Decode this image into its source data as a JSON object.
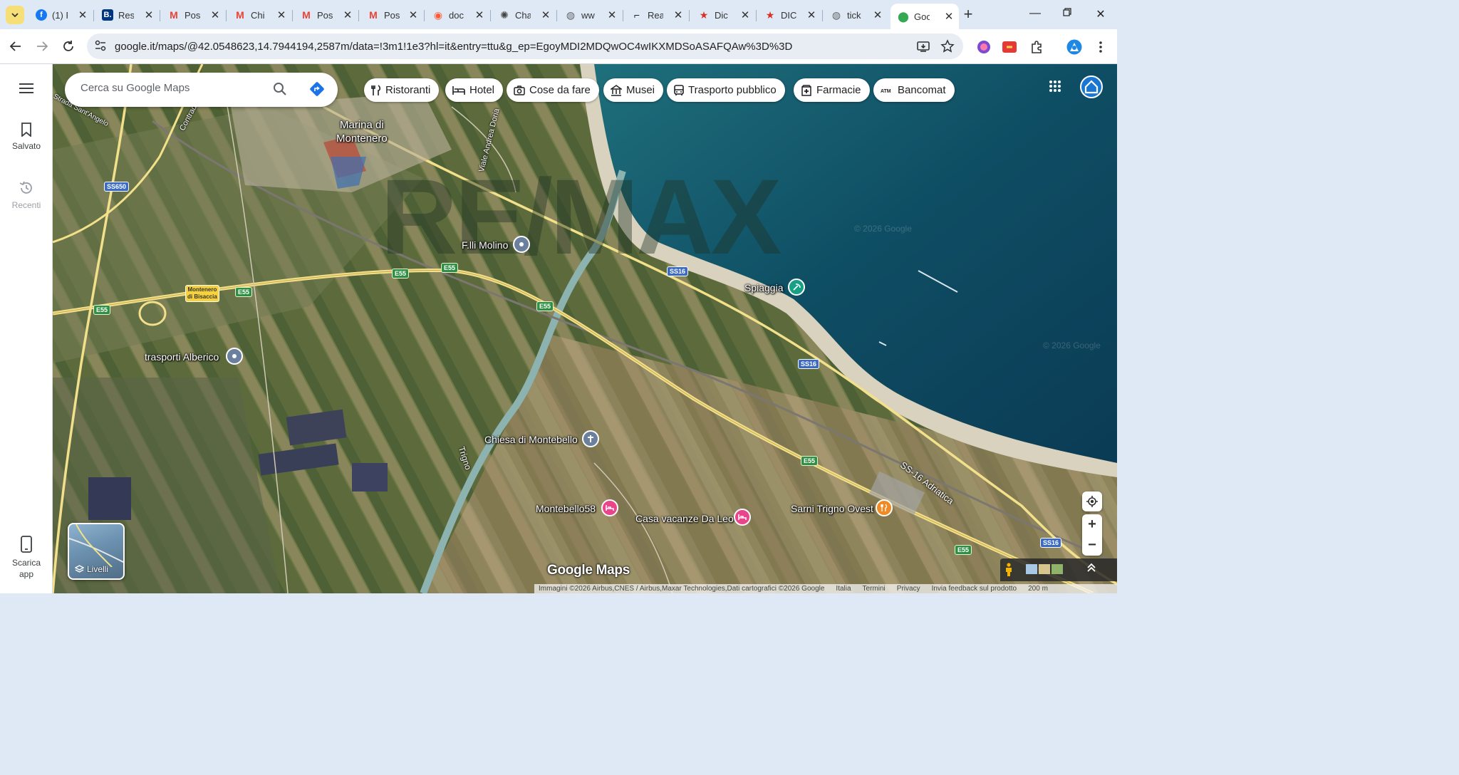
{
  "browser": {
    "tabs": [
      {
        "label": "(1) F",
        "favicon": "facebook",
        "color": "#1877f2"
      },
      {
        "label": "Res",
        "favicon": "booking",
        "color": "#003580"
      },
      {
        "label": "Pos",
        "favicon": "gmail",
        "color": "#ea4335"
      },
      {
        "label": "Chi",
        "favicon": "gmail",
        "color": "#ea4335"
      },
      {
        "label": "Pos",
        "favicon": "gmail",
        "color": "#ea4335"
      },
      {
        "label": "Pos",
        "favicon": "gmail",
        "color": "#ea4335"
      },
      {
        "label": "doc",
        "favicon": "doc",
        "color": "#ff5a36"
      },
      {
        "label": "Cha",
        "favicon": "chatgpt",
        "color": "#444444"
      },
      {
        "label": "ww",
        "favicon": "globe",
        "color": "#5f6368"
      },
      {
        "label": "Rea",
        "favicon": "read",
        "color": "#222222"
      },
      {
        "label": "Dic",
        "favicon": "star",
        "color": "#d93025"
      },
      {
        "label": "DIC",
        "favicon": "star",
        "color": "#d93025"
      },
      {
        "label": "tick",
        "favicon": "globe",
        "color": "#5f6368"
      },
      {
        "label": "Goo",
        "favicon": "maps-pin",
        "color": "#34a853",
        "active": true
      }
    ],
    "new_tab_icon": "plus-icon",
    "url": "google.it/maps/@42.0548623,14.7944194,2587m/data=!3m1!1e3?hl=it&entry=ttu&g_ep=EgoyMDI2MDQwOC4wIKXMDSoASAFQAw%3D%3D"
  },
  "rail": {
    "saved_label": "Salvato",
    "recent_label": "Recenti",
    "download_label": "Scarica app"
  },
  "search": {
    "placeholder": "Cerca su Google Maps"
  },
  "chips": [
    {
      "label": "Ristoranti",
      "icon": "fork-knife-icon"
    },
    {
      "label": "Hotel",
      "icon": "bed-icon"
    },
    {
      "label": "Cose da fare",
      "icon": "camera-icon"
    },
    {
      "label": "Musei",
      "icon": "museum-icon"
    },
    {
      "label": "Trasporto pubblico",
      "icon": "bus-icon"
    },
    {
      "label": "Farmacie",
      "icon": "pharmacy-icon"
    },
    {
      "label": "Bancomat",
      "icon": "atm-icon"
    }
  ],
  "map": {
    "places": {
      "marina": "Marina di\nMontenero",
      "molino": "F.lli Molino",
      "spiaggia": "Spiaggia",
      "alberico": "trasporti Alberico",
      "chiesa": "Chiesa di Montebello",
      "montebello58": "Montebello58",
      "casa": "Casa vacanze Da Leo",
      "sarni": "Sarni Trigno Ovest"
    },
    "roads": {
      "ss650": "SS650",
      "e55": "E55",
      "ss16": "SS16",
      "ss16_adriatica": "SS-16 Adriatica",
      "viale_doria": "Viale Andrea Doria",
      "trigno": "Trigno",
      "santangelo": "Strada Sant'Angelo",
      "contrada": "Contrada",
      "exit_sign": "Montenero\ndi Bisaccia"
    },
    "watermark": "RE/MAX",
    "copyright_faint": "© 2026 Google",
    "layers_label": "Livelli",
    "logo_text": "Google Maps",
    "attribution": {
      "imagery": "Immagini ©2026 Airbus,CNES / Airbus,Maxar Technologies,Dati cartografici ©2026 Google",
      "country": "Italia",
      "terms": "Termini",
      "privacy": "Privacy",
      "feedback": "Invia feedback sul prodotto",
      "scale": "200 m"
    }
  }
}
